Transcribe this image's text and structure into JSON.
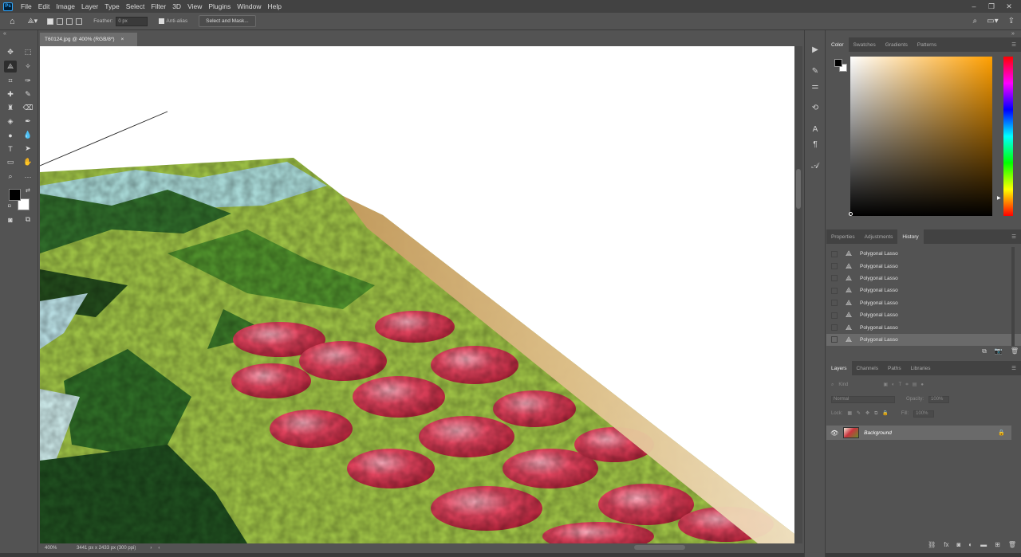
{
  "app": {
    "logo": "Ps"
  },
  "menu": [
    "File",
    "Edit",
    "Image",
    "Layer",
    "Type",
    "Select",
    "Filter",
    "3D",
    "View",
    "Plugins",
    "Window",
    "Help"
  ],
  "options": {
    "feather_label": "Feather:",
    "feather_value": "0 px",
    "antialias_label": "Anti-alias",
    "select_mask_label": "Select and Mask..."
  },
  "document": {
    "tab_title": "T60124.jpg @ 400% (RGB/8*)"
  },
  "status": {
    "zoom": "400%",
    "info": "3441 px x 2433 px (300 ppi)"
  },
  "color_panel": {
    "tabs": [
      "Color",
      "Swatches",
      "Gradients",
      "Patterns"
    ],
    "active_tab": "Color",
    "hue_color": "#ff9f00",
    "foreground": "#000000",
    "background": "#ffffff"
  },
  "history_panel": {
    "tabs": [
      "Properties",
      "Adjustments",
      "History"
    ],
    "active_tab": "History",
    "items": [
      "Polygonal Lasso",
      "Polygonal Lasso",
      "Polygonal Lasso",
      "Polygonal Lasso",
      "Polygonal Lasso",
      "Polygonal Lasso",
      "Polygonal Lasso",
      "Polygonal Lasso"
    ]
  },
  "layers_panel": {
    "tabs": [
      "Layers",
      "Channels",
      "Paths",
      "Libraries"
    ],
    "active_tab": "Layers",
    "kind_label": "Kind",
    "blend_mode": "Normal",
    "opacity_label": "Opacity:",
    "opacity_value": "100%",
    "lock_label": "Lock:",
    "fill_label": "Fill:",
    "fill_value": "100%",
    "layers": [
      {
        "name": "Background",
        "visible": true,
        "locked": true
      }
    ]
  }
}
